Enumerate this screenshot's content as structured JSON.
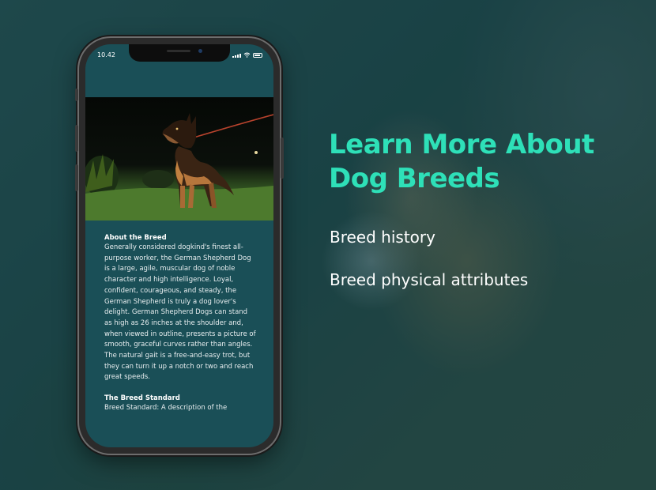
{
  "phone": {
    "status_time": "10.42",
    "sections": [
      {
        "title": "About the Breed",
        "text": "Generally considered dogkind's finest all-purpose worker, the German Shepherd Dog is a large, agile, muscular dog of noble character and high intelligence. Loyal, confident, courageous, and steady, the German Shepherd is truly a dog lover's delight. German Shepherd Dogs can stand as high as 26 inches at the shoulder and, when viewed in outline, presents a picture of smooth, graceful curves rather than angles. The natural gait is a free-and-easy trot, but they can turn it up a notch or two and reach great speeds."
      },
      {
        "title": "The Breed Standard",
        "text": "Breed Standard: A description of the"
      }
    ]
  },
  "promo": {
    "headline_line1": "Learn More About",
    "headline_line2": "Dog Breeds",
    "features": [
      "Breed history",
      "Breed physical attributes"
    ]
  },
  "colors": {
    "accent": "#2ee0b8",
    "screen_bg": "#1a4f57"
  }
}
